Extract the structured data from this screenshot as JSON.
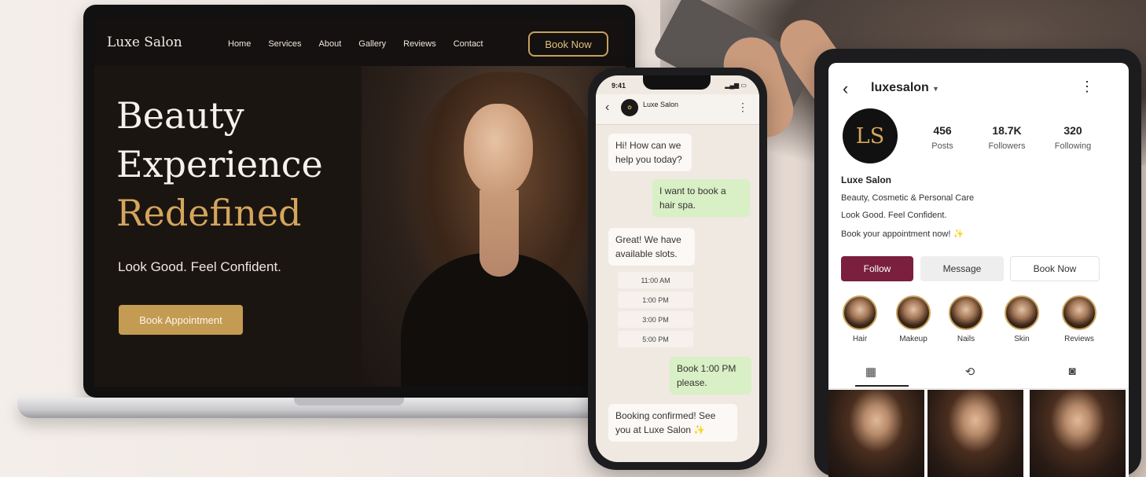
{
  "laptop": {
    "logo": "Luxe Salon",
    "nav": [
      "Home",
      "Services",
      "About",
      "Gallery",
      "Reviews",
      "Contact"
    ],
    "book_now": "Book Now",
    "hero": {
      "line1": "Beauty",
      "line2": "Experience",
      "line3": "Redefined",
      "subtitle": "Look Good. Feel Confident.",
      "cta": "Book Appointment"
    }
  },
  "phone": {
    "time": "9:41",
    "chat_name": "Luxe Salon",
    "messages": [
      {
        "dir": "in",
        "text": "Hi! How can we help you today?"
      },
      {
        "dir": "out",
        "text": "I want to book a hair spa."
      },
      {
        "dir": "in",
        "text": "Great! We have available slots."
      },
      {
        "dir": "out",
        "text": "Book 1:00 PM please."
      },
      {
        "dir": "in",
        "text": "Booking confirmed! See you at Luxe Salon ✨"
      }
    ],
    "slots": [
      "11:00 AM",
      "1:00 PM",
      "3:00 PM",
      "5:00 PM"
    ]
  },
  "tablet": {
    "handle": "luxesalon",
    "avatar_text": "LS",
    "stats": [
      {
        "num": "456",
        "label": "Posts"
      },
      {
        "num": "18.7K",
        "label": "Followers"
      },
      {
        "num": "320",
        "label": "Following"
      }
    ],
    "name": "Luxe Salon",
    "bio": [
      "Beauty, Cosmetic & Personal Care",
      "Look Good. Feel Confident.",
      "Book your appointment now! ✨"
    ],
    "buttons": {
      "follow": "Follow",
      "message": "Message",
      "book": "Book Now"
    },
    "highlights": [
      "Hair",
      "Makeup",
      "Nails",
      "Skin",
      "Reviews"
    ]
  },
  "colors": {
    "gold": "#c49b52",
    "follow": "#7a1f3e",
    "chat_out": "#d9efc5"
  }
}
